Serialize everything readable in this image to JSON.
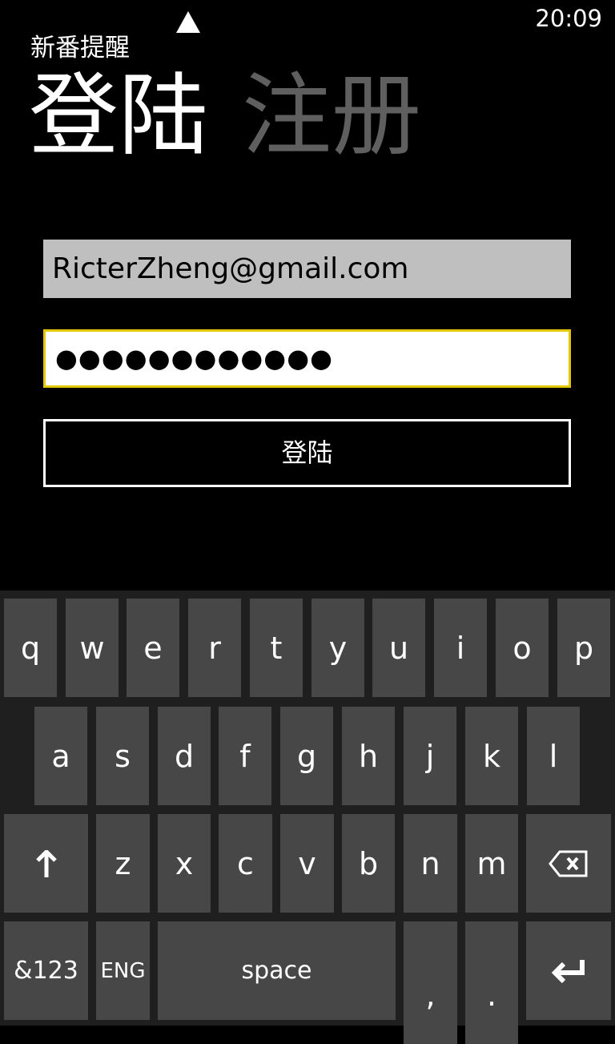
{
  "status_bar": {
    "time": "20:09"
  },
  "app": {
    "title": "新番提醒"
  },
  "pivot": {
    "items": [
      {
        "label": "登陆",
        "active": true
      },
      {
        "label": "注册",
        "active": false
      }
    ]
  },
  "form": {
    "email_value": "RicterZheng@gmail.com",
    "password_masked": "●●●●●●●●●●●●",
    "login_button": "登陆",
    "focus_color": "#e3c800"
  },
  "keyboard": {
    "rows": [
      [
        "q",
        "w",
        "e",
        "r",
        "t",
        "y",
        "u",
        "i",
        "o",
        "p"
      ],
      [
        "a",
        "s",
        "d",
        "f",
        "g",
        "h",
        "j",
        "k",
        "l"
      ],
      [
        "shift-icon",
        "z",
        "x",
        "c",
        "v",
        "b",
        "n",
        "m",
        "backspace-icon"
      ],
      [
        "&123",
        "ENG",
        "space",
        ",",
        ".",
        "enter-icon"
      ]
    ]
  }
}
